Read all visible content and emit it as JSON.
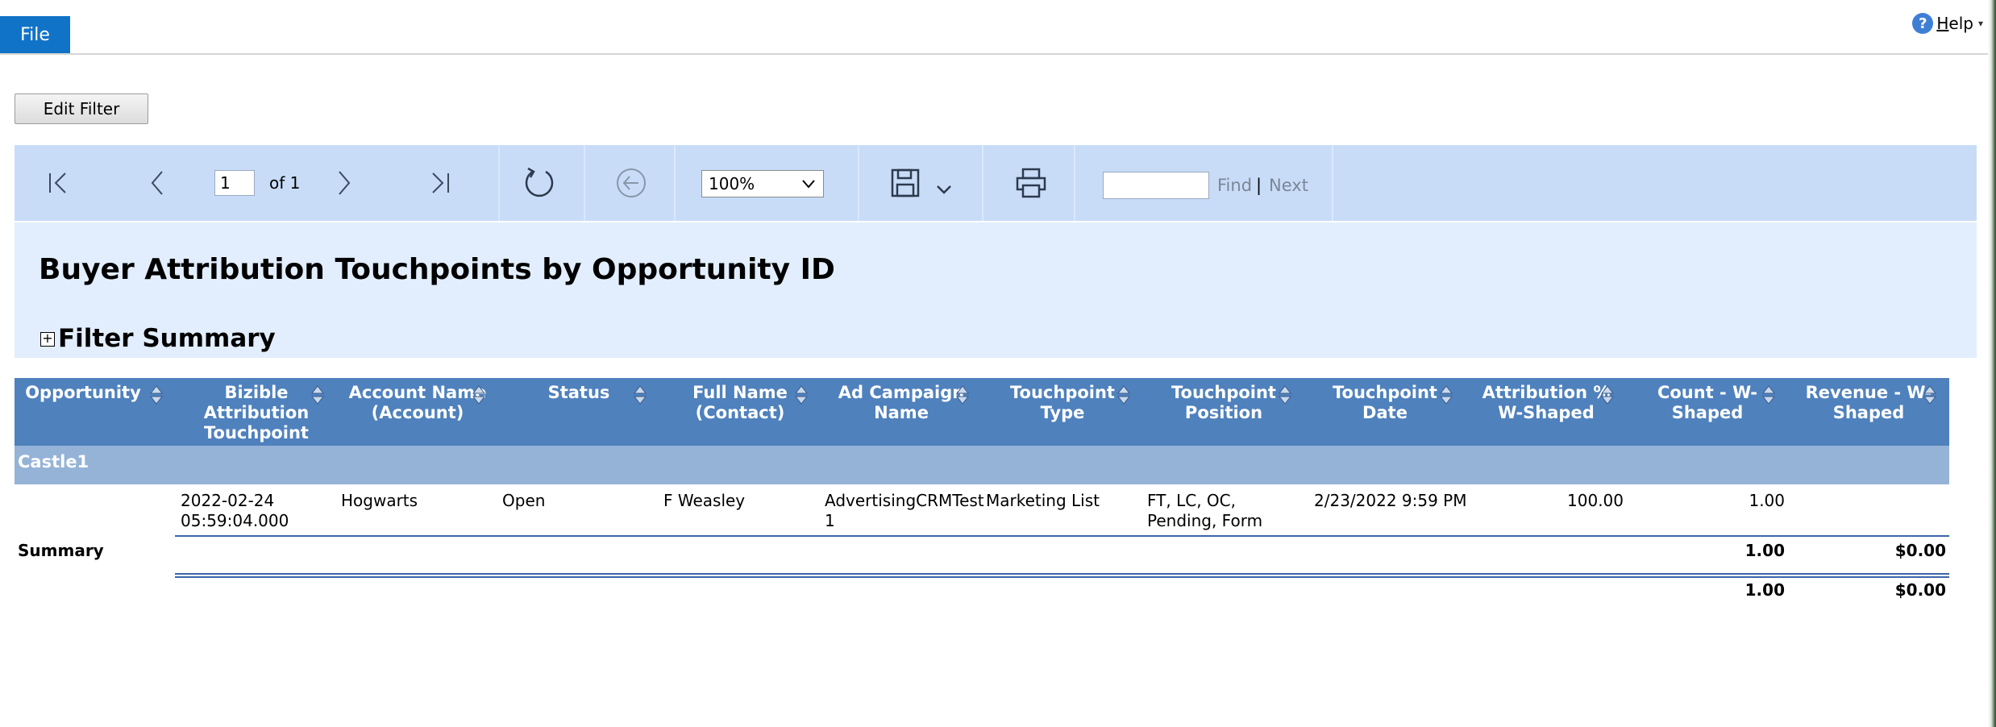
{
  "menu": {
    "file_label": "File"
  },
  "help": {
    "icon_text": "?",
    "label": "Help",
    "caret": "▾"
  },
  "actions": {
    "edit_filter_label": "Edit Filter"
  },
  "toolbar": {
    "page_value": "1",
    "of_label": "of 1",
    "zoom_value": "100%",
    "find_label": "Find",
    "find_separator": "|",
    "next_label": "Next",
    "find_value": ""
  },
  "report": {
    "title": "Buyer Attribution Touchpoints by Opportunity ID",
    "filter_toggle": "+",
    "filter_summary_label": "Filter Summary"
  },
  "table": {
    "columns": [
      [
        "Opportunity"
      ],
      [
        "Bizible",
        "Attribution",
        "Touchpoint"
      ],
      [
        "Account Name",
        "(Account)"
      ],
      [
        "Status"
      ],
      [
        "Full Name",
        "(Contact)"
      ],
      [
        "Ad Campaign",
        "Name"
      ],
      [
        "Touchpoint",
        "Type"
      ],
      [
        "Touchpoint",
        "Position"
      ],
      [
        "Touchpoint",
        "Date"
      ],
      [
        "Attribution %",
        "W-Shaped"
      ],
      [
        "Count - W-",
        "Shaped"
      ],
      [
        "Revenue - W-",
        "Shaped"
      ]
    ],
    "group": "Castle1",
    "row": {
      "touchpoint": [
        "2022-02-24",
        "05:59:04.000"
      ],
      "account": "Hogwarts",
      "status": "Open",
      "contact": "F Weasley",
      "campaign": [
        "AdvertisingCRMTest",
        "1"
      ],
      "type": "Marketing List",
      "position": [
        "FT, LC, OC,",
        "Pending, Form"
      ],
      "date": "2/23/2022 9:59 PM",
      "attribution": "100.00",
      "count": "1.00"
    },
    "summary": {
      "label": "Summary",
      "count": "1.00",
      "revenue": "$0.00"
    },
    "total": {
      "count": "1.00",
      "revenue": "$0.00"
    }
  },
  "colors": {
    "accent": "#1173c7",
    "header": "#4f81bd",
    "group": "#95b3d7",
    "toolbar": "#c8dcf8",
    "report_bg": "#e2eefd"
  }
}
